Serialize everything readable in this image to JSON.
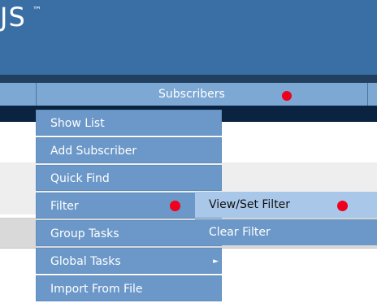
{
  "header": {
    "logo_text": "JS",
    "tm": "™"
  },
  "nav": {
    "tab_label": "Subscribers"
  },
  "menu": {
    "items": [
      {
        "label": "Show List",
        "has_submenu": false
      },
      {
        "label": "Add Subscriber",
        "has_submenu": false
      },
      {
        "label": "Quick Find",
        "has_submenu": false
      },
      {
        "label": "Filter",
        "has_submenu": true
      },
      {
        "label": "Group Tasks",
        "has_submenu": false
      },
      {
        "label": "Global Tasks",
        "has_submenu": true
      },
      {
        "label": "Import From File",
        "has_submenu": false
      }
    ],
    "submenu_arrow": "►"
  },
  "submenu": {
    "items": [
      {
        "label": "View/Set Filter",
        "state": "highlighted"
      },
      {
        "label": "Clear Filter",
        "state": "normal"
      }
    ]
  },
  "colors": {
    "header_bg": "#3a6fa6",
    "nav_bg": "#7ea8d4",
    "menu_bg": "#6b98c8",
    "menu_highlight": "#a9c7e8",
    "marker_red": "#f0001c"
  }
}
